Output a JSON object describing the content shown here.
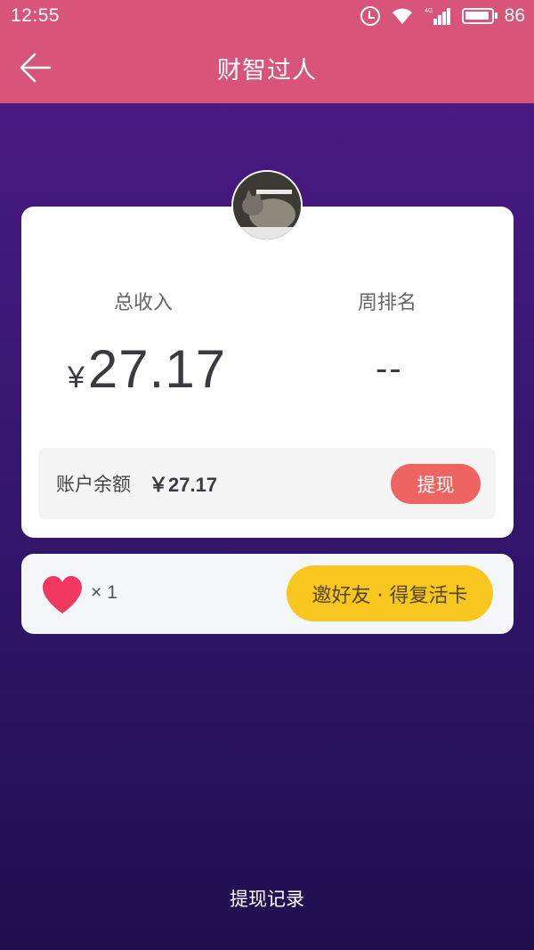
{
  "status_bar": {
    "time": "12:55",
    "network_label": "4G",
    "battery_level": "86",
    "icons": [
      "alarm-icon",
      "wifi-icon",
      "signal-icon",
      "battery-icon"
    ]
  },
  "app_bar": {
    "title": "财智过人",
    "back_icon": "back-arrow-icon"
  },
  "stats": {
    "total_income_label": "总收入",
    "total_income_currency": "¥",
    "total_income_value": "27.17",
    "weekly_rank_label": "周排名",
    "weekly_rank_value": "--"
  },
  "balance": {
    "label": "账户余额",
    "value": "￥27.17",
    "withdraw_label": "提现"
  },
  "lives": {
    "icon": "heart-icon",
    "count": "× 1",
    "invite_label": "邀好友 · 得复活卡"
  },
  "footer": {
    "records_label": "提现记录"
  },
  "colors": {
    "app_bar": "#d95479",
    "withdraw_button": "#ef6460",
    "invite_button": "#f8c71f",
    "heart": "#f2385f"
  }
}
